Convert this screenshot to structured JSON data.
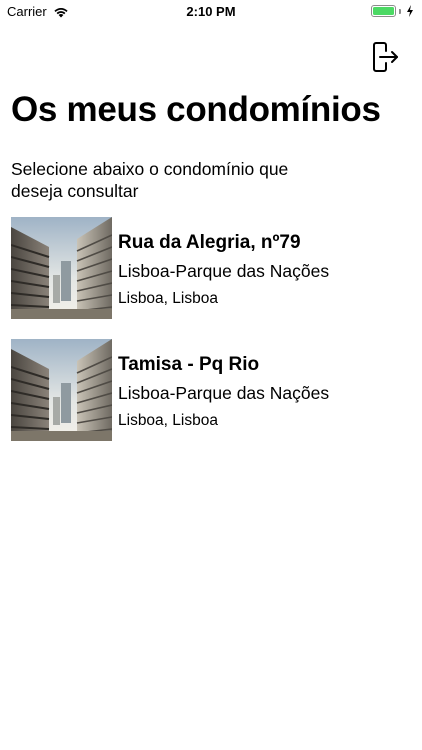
{
  "status_bar": {
    "carrier": "Carrier",
    "time": "2:10 PM",
    "battery_percent": 100,
    "battery_color": "#4cd964"
  },
  "header": {
    "logout_icon": "logout-icon",
    "title": "Os meus condomínios",
    "subtitle": "Selecione abaixo o condomínio que deseja consultar"
  },
  "condominiums": [
    {
      "name": "Rua da Alegria, nº79",
      "area": "Lisboa-Parque das Nações",
      "location": "Lisboa, Lisboa"
    },
    {
      "name": "Tamisa - Pq Rio",
      "area": "Lisboa-Parque das Nações",
      "location": "Lisboa, Lisboa"
    }
  ]
}
